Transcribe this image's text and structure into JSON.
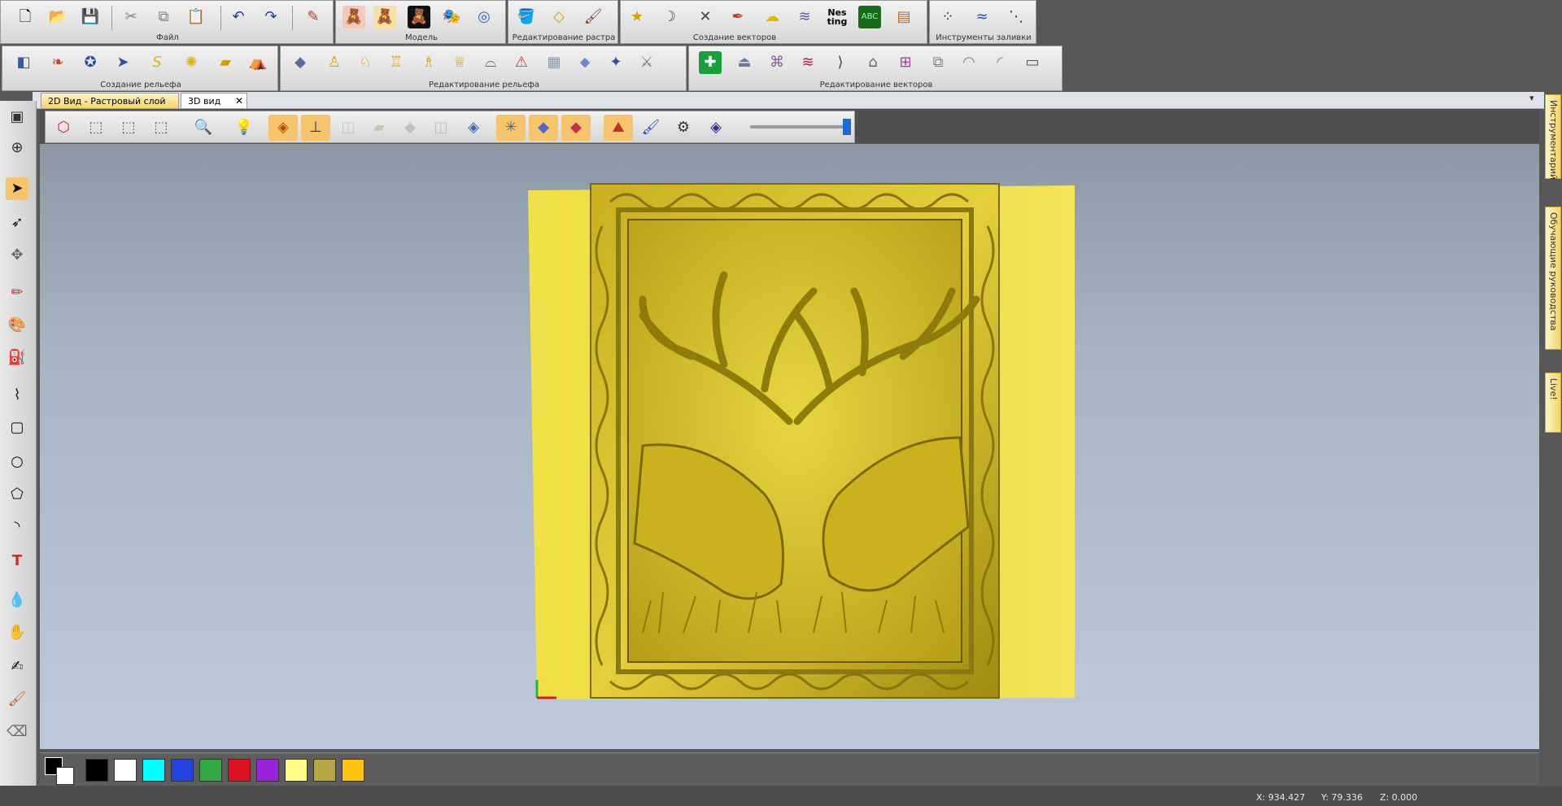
{
  "toolbars": {
    "file_group": "Файл",
    "model_group": "Модель",
    "raster_group": "Редактирование растра",
    "vector_create_group": "Создание векторов",
    "fill_tools_group": "Инструменты заливки",
    "relief_create_group": "Создание рельефа",
    "relief_edit_group": "Редактирование рельефа",
    "vector_edit_group": "Редактирование векторов",
    "nesting_label": "Nes\nting",
    "nesting_label_line1": "Nes",
    "nesting_label_line2": "ting"
  },
  "tabs": [
    {
      "label": "2D Вид - Растровый слой"
    },
    {
      "label": "3D вид"
    }
  ],
  "right_panel": {
    "tabs": [
      {
        "label": "Инструментарий"
      },
      {
        "label": "Обучающие руководства"
      },
      {
        "label": "Live!"
      }
    ]
  },
  "palette": {
    "colors": [
      "#000000",
      "#ffffff",
      "#00ffff",
      "#2244dd",
      "#33aa44",
      "#dd1122",
      "#9922dd",
      "#ffff88",
      "#b3a640",
      "#ffc20e"
    ]
  },
  "status": {
    "x": "X: 934.427",
    "y": "Y: 79.336",
    "z": "Z: 0.000"
  },
  "colors": {
    "relief_yellow": "#e8d535",
    "view_top": "#8c98a6",
    "view_bottom": "#bccadb",
    "tab_active": "#ffffff"
  }
}
